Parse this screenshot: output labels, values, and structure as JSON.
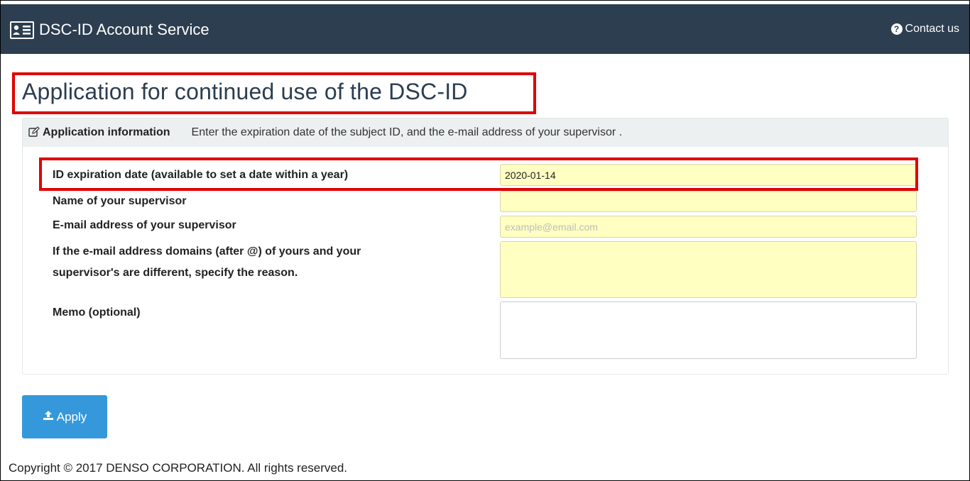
{
  "header": {
    "brand": "DSC-ID Account Service",
    "brand_icon": "address-card-icon",
    "contact": "Contact us",
    "contact_icon": "question-circle-icon",
    "bg_color": "#2c3e50"
  },
  "main": {
    "title": "Application for continued use of the DSC-ID",
    "panel": {
      "heading": "Application information",
      "heading_icon": "edit-icon",
      "description": "Enter the expiration date of the subject ID, and the e-mail address of your supervisor ."
    },
    "fields": {
      "expiration": {
        "label": "ID expiration date (available to set a date within a year)",
        "value": "2020-01-14"
      },
      "supervisor_name": {
        "label": "Name of your supervisor",
        "value": ""
      },
      "supervisor_email": {
        "label": "E-mail address of your supervisor",
        "placeholder": "example@email.com",
        "value": ""
      },
      "reason": {
        "label_line1": "If the e-mail address domains (after @) of yours and your",
        "label_line2": "supervisor's are different, specify the reason.",
        "value": ""
      },
      "memo": {
        "label": "Memo (optional)",
        "value": ""
      }
    },
    "apply_button": "Apply",
    "apply_icon": "upload-icon",
    "highlight_color": "#e00000",
    "required_field_color": "#ffffc2"
  },
  "footer": {
    "copyright": "Copyright © 2017 DENSO CORPORATION. All rights reserved."
  }
}
